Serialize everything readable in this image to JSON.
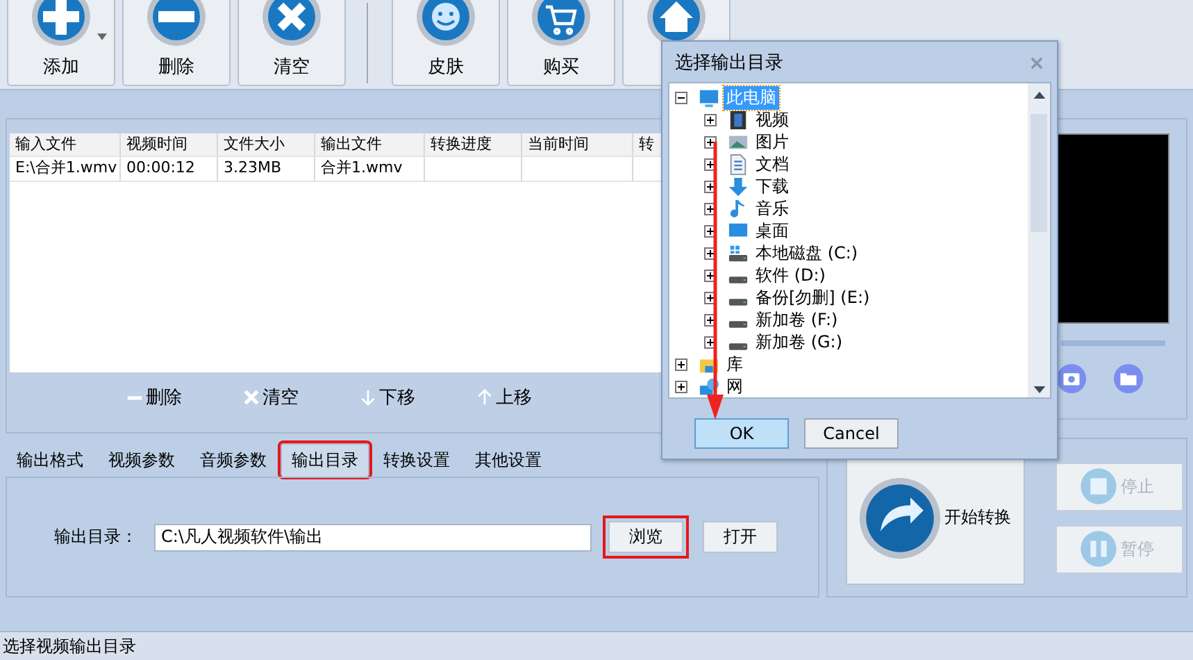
{
  "toolbar": {
    "buttons": [
      {
        "label": "添加",
        "kind": "plus",
        "dropdown": true
      },
      {
        "label": "删除",
        "kind": "minus",
        "dropdown": false
      },
      {
        "label": "清空",
        "kind": "cross",
        "dropdown": false
      },
      {
        "label": "皮肤",
        "kind": "smiley",
        "dropdown": false
      },
      {
        "label": "购买",
        "kind": "cart",
        "dropdown": false
      },
      {
        "kind": "home",
        "dropdown": false
      }
    ]
  },
  "file_table": {
    "columns": [
      "输入文件",
      "视频时间",
      "文件大小",
      "输出文件",
      "转换进度",
      "当前时间",
      "转"
    ],
    "rows": [
      {
        "cells": [
          "E:\\合并1.wmv",
          "00:00:12",
          "3.23MB",
          "合并1.wmv"
        ]
      }
    ]
  },
  "list_actions": [
    {
      "label": "删除",
      "kind": "minus"
    },
    {
      "label": "清空",
      "kind": "cross"
    },
    {
      "label": "下移",
      "kind": "down"
    },
    {
      "label": "上移",
      "kind": "up"
    }
  ],
  "settings_tabs": [
    {
      "label": "输出格式",
      "selected": false,
      "highlighted": false
    },
    {
      "label": "视频参数",
      "selected": false,
      "highlighted": false
    },
    {
      "label": "音频参数",
      "selected": false,
      "highlighted": false
    },
    {
      "label": "输出目录",
      "selected": true,
      "highlighted": true
    },
    {
      "label": "转换设置",
      "selected": false,
      "highlighted": false
    },
    {
      "label": "其他设置",
      "selected": false,
      "highlighted": false
    }
  ],
  "output_dir": {
    "label": "输出目录：",
    "value": "C:\\凡人视频软件\\输出",
    "buttons": [
      {
        "label": "浏览",
        "highlighted": true
      },
      {
        "label": "打开",
        "highlighted": false
      }
    ]
  },
  "convert": {
    "start": "开始转换",
    "controls": [
      {
        "label": "停止",
        "kind": "stop",
        "disabled": true
      },
      {
        "label": "暂停",
        "kind": "pause",
        "disabled": true
      }
    ]
  },
  "status_bar": "选择视频输出目录",
  "dialog": {
    "title": "选择输出目录",
    "tree": [
      {
        "label": "此电脑",
        "kind": "computer",
        "expanded": true,
        "selected": true,
        "children": [
          {
            "label": "视频",
            "kind": "video",
            "expanded": false,
            "selected": false
          },
          {
            "label": "图片",
            "kind": "image",
            "expanded": false,
            "selected": false
          },
          {
            "label": "文档",
            "kind": "document",
            "expanded": false,
            "selected": false
          },
          {
            "label": "下载",
            "kind": "download",
            "expanded": false,
            "selected": false
          },
          {
            "label": "音乐",
            "kind": "music",
            "expanded": false,
            "selected": false
          },
          {
            "label": "桌面",
            "kind": "desktop",
            "expanded": false,
            "selected": false
          },
          {
            "label": "本地磁盘 (C:)",
            "kind": "system-drive",
            "expanded": false,
            "selected": false
          },
          {
            "label": "软件 (D:)",
            "kind": "drive",
            "expanded": false,
            "selected": false
          },
          {
            "label": "备份[勿删] (E:)",
            "kind": "drive",
            "expanded": false,
            "selected": false
          },
          {
            "label": "新加卷 (F:)",
            "kind": "drive",
            "expanded": false,
            "selected": false
          },
          {
            "label": "新加卷 (G:)",
            "kind": "drive",
            "expanded": false,
            "selected": false
          }
        ]
      },
      {
        "label": "库",
        "kind": "library",
        "expanded": false,
        "selected": false
      },
      {
        "label": "网",
        "kind": "network",
        "expanded": false,
        "selected": false
      }
    ],
    "buttons": [
      {
        "label": "OK",
        "default": true
      },
      {
        "label": "Cancel",
        "default": false
      }
    ]
  }
}
